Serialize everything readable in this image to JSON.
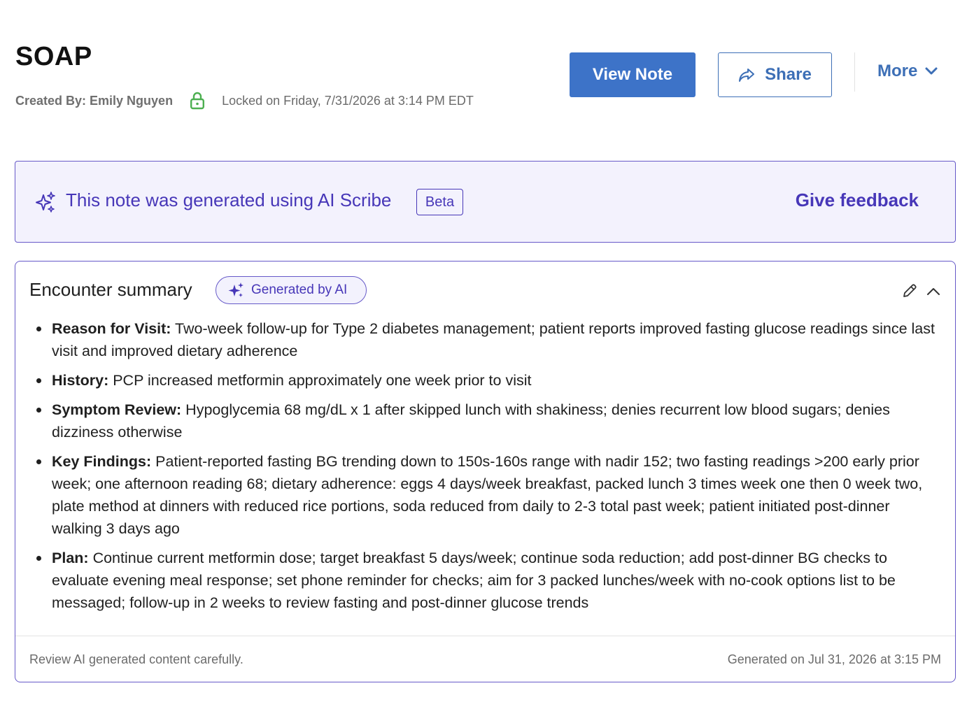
{
  "header": {
    "title": "SOAP",
    "created_by": "Created By: Emily Nguyen",
    "locked_text": "Locked on Friday, 7/31/2026 at 3:14 PM EDT",
    "lock_icon": "lock-icon",
    "lock_color": "#4caf50"
  },
  "actions": {
    "view_note_label": "View Note",
    "share_label": "Share",
    "share_icon": "share-icon",
    "more_label": "More",
    "more_icon": "chevron-down-icon",
    "primary_color": "#3d73c8"
  },
  "ai_banner": {
    "text": "This note was generated using AI Scribe",
    "beta_label": "Beta",
    "feedback_label": "Give feedback",
    "icon": "sparkle-icon",
    "accent_color": "#4737b8",
    "background": "#f3f2fd"
  },
  "summary": {
    "title": "Encounter summary",
    "badge_label": "Generated by AI",
    "items": [
      {
        "label": "Reason for Visit:",
        "text": "Two-week follow-up for Type 2 diabetes management; patient reports improved fasting glucose readings since last visit and improved dietary adherence"
      },
      {
        "label": "History:",
        "text": "PCP increased metformin approximately one week prior to visit"
      },
      {
        "label": "Symptom Review:",
        "text": "Hypoglycemia 68 mg/dL x 1 after skipped lunch with shakiness; denies recurrent low blood sugars; denies dizziness otherwise"
      },
      {
        "label": "Key Findings:",
        "text": "Patient-reported fasting BG trending down to 150s-160s range with nadir 152; two fasting readings >200 early prior week; one afternoon reading 68; dietary adherence: eggs 4 days/week breakfast, packed lunch 3 times week one then 0 week two, plate method at dinners with reduced rice portions, soda reduced from daily to 2-3 total past week; patient initiated post-dinner walking 3 days ago"
      },
      {
        "label": "Plan:",
        "text": "Continue current metformin dose; target breakfast 5 days/week; continue soda reduction; add post-dinner BG checks to evaluate evening meal response; set phone reminder for checks; aim for 3 packed lunches/week with no-cook options list to be messaged; follow-up in 2 weeks to review fasting and post-dinner glucose trends"
      }
    ],
    "footer_disclaimer": "Review AI generated content carefully.",
    "footer_generated": "Generated on Jul 31, 2026 at 3:15 PM"
  }
}
